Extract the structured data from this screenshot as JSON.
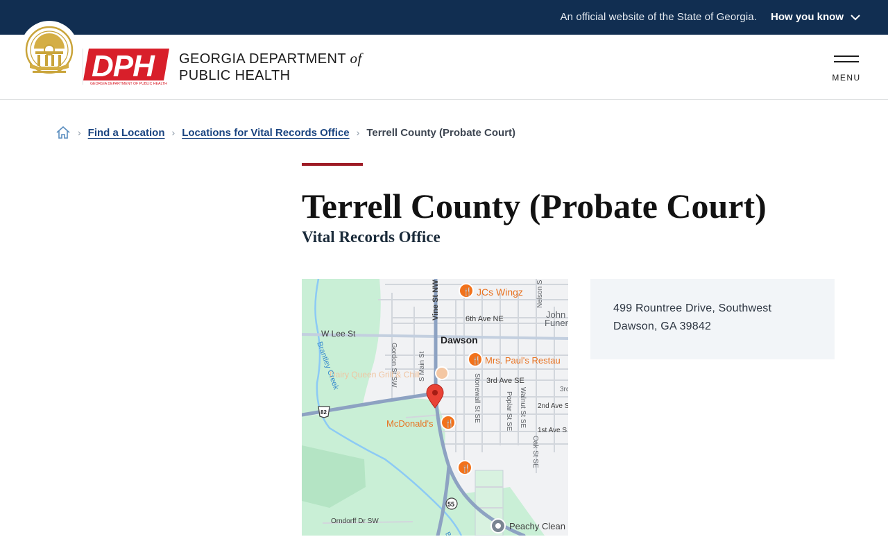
{
  "gov_banner": {
    "text": "An official website of the State of Georgia.",
    "how_label": "How you know"
  },
  "header": {
    "dph_mark": "DPH",
    "dph_tagline": "GEORGIA DEPARTMENT OF PUBLIC HEALTH",
    "org_line1_pre": "GEORGIA DEPARTMENT ",
    "org_line1_of": "of",
    "org_line2": "PUBLIC HEALTH",
    "menu_label": "MENU"
  },
  "breadcrumb": {
    "items": [
      "Find a Location",
      "Locations for Vital Records Office"
    ],
    "current": "Terrell County (Probate Court)"
  },
  "page": {
    "title": "Terrell County (Probate Court)",
    "subtitle": "Vital Records Office"
  },
  "map": {
    "labels": {
      "jcs": "JCs Wingz",
      "vine": "Vine St NW",
      "nelson": "Nelson S",
      "john": "John",
      "funer": "Funer",
      "sixth": "6th Ave NE",
      "wlee": "W Lee St",
      "dawson": "Dawson",
      "gordon": "Gordon St SW",
      "mainst": "S Main St",
      "mrspauls": "Mrs. Paul's Restau",
      "dairyqueen": "Dairy Queen Grill & Chill",
      "stonewall": "Stonewall St SE",
      "third": "3rd Ave SE",
      "third2": "3rc",
      "brantley": "Brantley Creek",
      "walnut": "Walnut St SE",
      "poplar": "Poplar St SE",
      "second": "2nd Ave S",
      "mcdonalds": "McDonald's",
      "first": "1st Ave S",
      "oak": "Oak St SE",
      "hw82": "82",
      "hw55": "55",
      "orndorff": "Orndorff Dr SW",
      "peachy": "Peachy Clean",
      "br": "Br"
    },
    "colors": {
      "pin": "#e94235",
      "poi": "#f2721b",
      "park": "#c9efd6",
      "water": "#8ccaf5",
      "highway": "#8da2c2"
    }
  },
  "address": {
    "line1": "499 Rountree Drive, Southwest",
    "line2": "Dawson, GA 39842"
  }
}
